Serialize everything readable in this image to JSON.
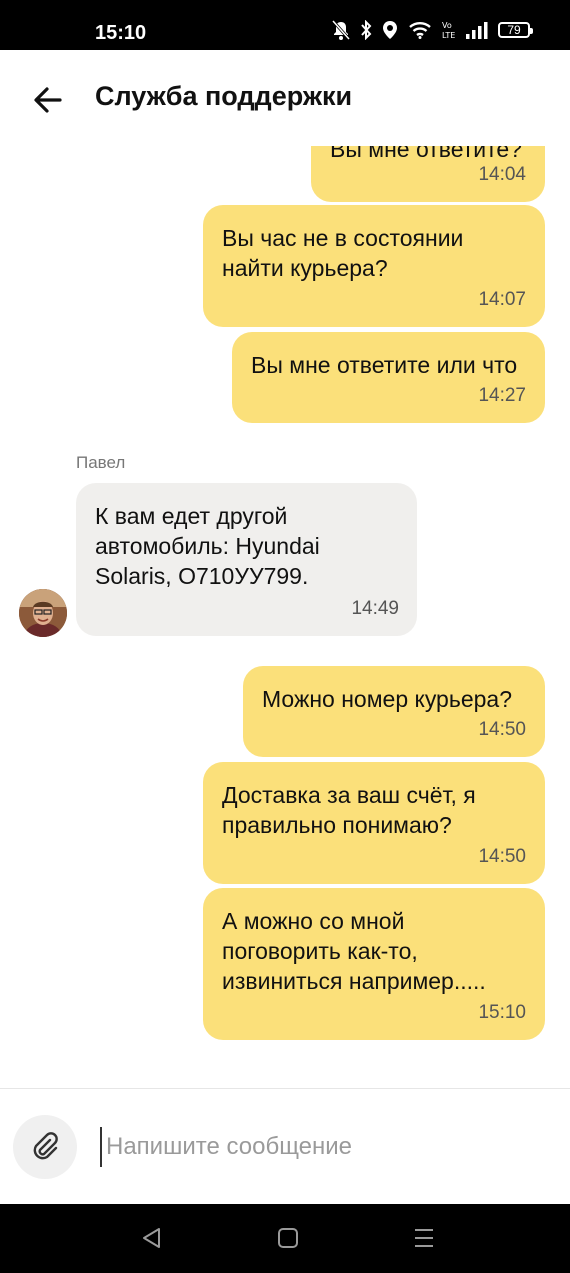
{
  "status_bar": {
    "time": "15:10",
    "battery": "79",
    "icons": [
      "bell-off-icon",
      "bluetooth-icon",
      "location-icon",
      "wifi-icon",
      "volte-icon",
      "signal-icon",
      "battery-icon"
    ]
  },
  "header": {
    "back_icon": "arrow-left-icon",
    "title": "Служба поддержки"
  },
  "messages": [
    {
      "direction": "out",
      "text": "Вы мне ответите?",
      "time": "14:04"
    },
    {
      "direction": "out",
      "text": "Вы час не в состоянии найти курьера?",
      "time": "14:07"
    },
    {
      "direction": "out",
      "text": "Вы мне ответите или что",
      "time": "14:27"
    },
    {
      "direction": "in",
      "sender": "Павел",
      "text": "К вам едет другой автомобиль: Hyundai Solaris, О710УУ799.",
      "time": "14:49"
    },
    {
      "direction": "out",
      "text": "Можно номер курьера?",
      "time": "14:50"
    },
    {
      "direction": "out",
      "text": "Доставка за ваш счёт, я правильно понимаю?",
      "time": "14:50"
    },
    {
      "direction": "out",
      "text": "А можно со мной поговорить как-то, извиниться например.....",
      "time": "15:10"
    }
  ],
  "composer": {
    "attach_icon": "paperclip-icon",
    "placeholder": "Напишите сообщение",
    "value": ""
  },
  "nav_bar": {
    "buttons": [
      "back-triangle-icon",
      "home-square-icon",
      "menu-lines-icon"
    ]
  },
  "colors": {
    "outgoing_bubble": "#fbe07a",
    "incoming_bubble": "#f0efed",
    "status_bar": "#000000"
  }
}
